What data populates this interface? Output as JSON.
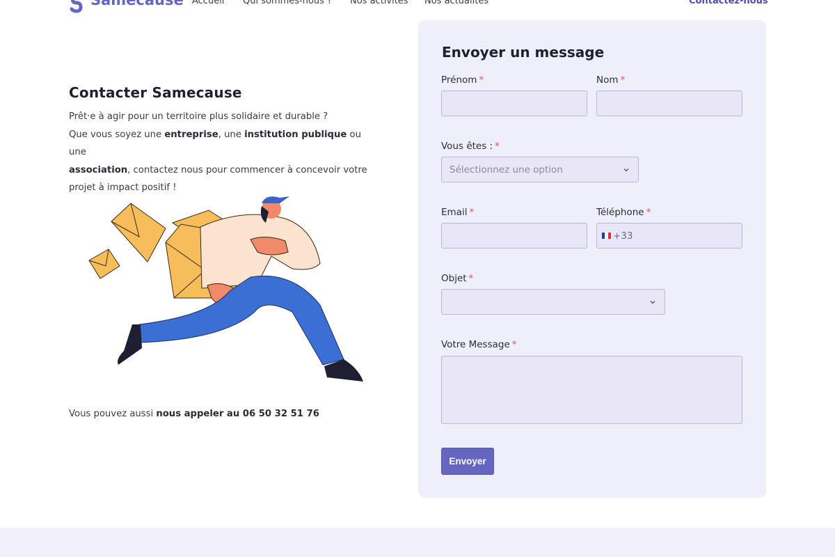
{
  "header": {
    "brand": "Samecause",
    "nav": [
      {
        "label": "Accueil"
      },
      {
        "label": "Qui sommes-nous ?"
      },
      {
        "label": "Nos activités"
      },
      {
        "label": "Nos actualités"
      }
    ],
    "contact_label": "Contactez-nous"
  },
  "intro": {
    "title": "Contacter Samecause",
    "line1": "Prêt·e à agir pour un territoire plus solidaire et durable ?",
    "line2_a": "Que vous soyez une ",
    "line2_b": "entreprise",
    "line2_c": ", une ",
    "line2_d": "institution publique",
    "line2_e": " ou une",
    "line3_a": "association",
    "line3_b": ", contactez nous pour commencer à concevoir votre",
    "line4": "projet à impact positif !",
    "phone_a": "Vous pouvez aussi ",
    "phone_b": "nous appeler au 06 50 32 51 76"
  },
  "form": {
    "title": "Envoyer un message",
    "required_mark": "*",
    "firstname_label": "Prénom",
    "firstname_value": "",
    "lastname_label": "Nom",
    "lastname_value": "",
    "type_label": "Vous êtes :",
    "type_placeholder": "Sélectionnez une option",
    "email_label": "Email",
    "email_value": "",
    "phone_label": "Téléphone",
    "phone_prefix": "+33",
    "subject_label": "Objet",
    "subject_value": "",
    "message_label": "Votre Message",
    "message_value": "",
    "submit_label": "Envoyer"
  },
  "colors": {
    "brand": "#6566c4",
    "card_bg": "#efeefb",
    "field_bg": "#e8e6f7",
    "required": "#e0505a"
  }
}
